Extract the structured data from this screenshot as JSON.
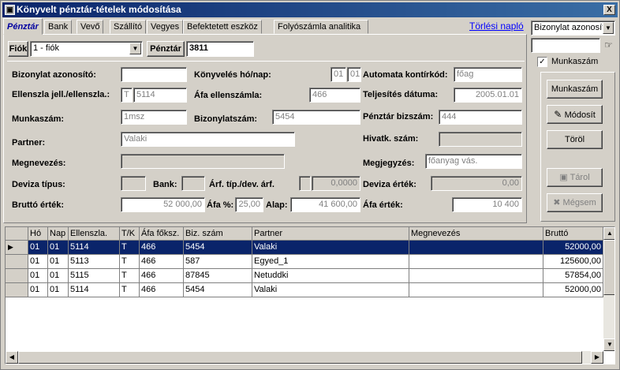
{
  "window": {
    "title": "Könyvelt pénztár-tételek módosítása",
    "close": "X",
    "icon": "app-icon"
  },
  "tabs": [
    {
      "label": "Pénztár",
      "active": true
    },
    {
      "label": "Bank"
    },
    {
      "label": "Vevő"
    },
    {
      "label": "Szállító"
    },
    {
      "label": "Vegyes"
    },
    {
      "label": "Befektetett eszköz"
    },
    {
      "label": "Folyószámla analitika"
    }
  ],
  "torlesi_naplo": "Törlési napló",
  "search": {
    "select_value": "Bizonylat azonosító",
    "input_value": "",
    "munkaszam_label": "Munkaszám",
    "munkaszam_checked": true
  },
  "buttons": {
    "munkaszam": "Munkaszám",
    "modosit": "Módosít",
    "torol": "Töröl",
    "tarol": "Tárol",
    "megsem": "Mégsem"
  },
  "top": {
    "fiok_label": "Fiók",
    "fiok_value": "1 - fiók",
    "penztar_label": "Pénztár",
    "penztar_value": "3811"
  },
  "form": {
    "bizonylat_azonosito_label": "Bizonylat azonosító:",
    "bizonylat_azonosito": "",
    "konyveles_label": "Könyvelés hó/nap:",
    "konyveles_ho": "01",
    "konyveles_nap": "01",
    "automata_label": "Automata kontírkód:",
    "automata": "főag",
    "ellenszla_label": "Ellenszla jell./ellenszla.:",
    "ellenszla_jell": "T",
    "ellenszla": "5114",
    "afa_ellenszamla_label": "Áfa ellenszámla:",
    "afa_ellenszamla": "466",
    "teljesites_label": "Teljesítés dátuma:",
    "teljesites": "2005.01.01",
    "munkaszam_label": "Munkaszám:",
    "munkaszam": "1msz",
    "bizonylatszam_label": "Bizonylatszám:",
    "bizonylatszam": "5454",
    "penztar_bizszam_label": "Pénztár bizszám:",
    "penztar_bizszam": "444",
    "partner_label": "Partner:",
    "partner": "Valaki",
    "hivatk_label": "Hivatk. szám:",
    "hivatk": "",
    "megnevezes_label": "Megnevezés:",
    "megnevezes": "",
    "megjegyzes_label": "Megjegyzés:",
    "megjegyzes": "főanyag vás.",
    "deviza_tipus_label": "Deviza típus:",
    "deviza_tipus": "",
    "bank_label": "Bank:",
    "bank": "",
    "arf_label": "Árf. típ./dev. árf.",
    "arf_tip": "",
    "arf": "0,0000",
    "deviza_ertek_label": "Deviza érték:",
    "deviza_ertek": "0,00",
    "brutto_label": "Bruttó érték:",
    "brutto": "52 000,00",
    "afa_pct_label": "Áfa %:",
    "afa_pct": "25,00",
    "alap_label": "Alap:",
    "alap": "41 600,00",
    "afa_ertek_label": "Áfa érték:",
    "afa_ertek": "10 400"
  },
  "grid": {
    "columns": [
      "Hó",
      "Nap",
      "Ellenszla.",
      "T/K",
      "Áfa főksz.",
      "Biz. szám",
      "Partner",
      "Megnevezés",
      "Bruttó"
    ],
    "rows": [
      [
        "01",
        "01",
        "5114",
        "T",
        "466",
        "5454",
        "Valaki",
        "",
        "52000,00"
      ],
      [
        "01",
        "01",
        "5113",
        "T",
        "466",
        "587",
        "Egyed_1",
        "",
        "125600,00"
      ],
      [
        "01",
        "01",
        "5115",
        "T",
        "466",
        "87845",
        "Netuddki",
        "",
        "57854,00"
      ],
      [
        "01",
        "01",
        "5114",
        "T",
        "466",
        "5454",
        "Valaki",
        "",
        "52000,00"
      ]
    ],
    "selected_row": 0
  }
}
